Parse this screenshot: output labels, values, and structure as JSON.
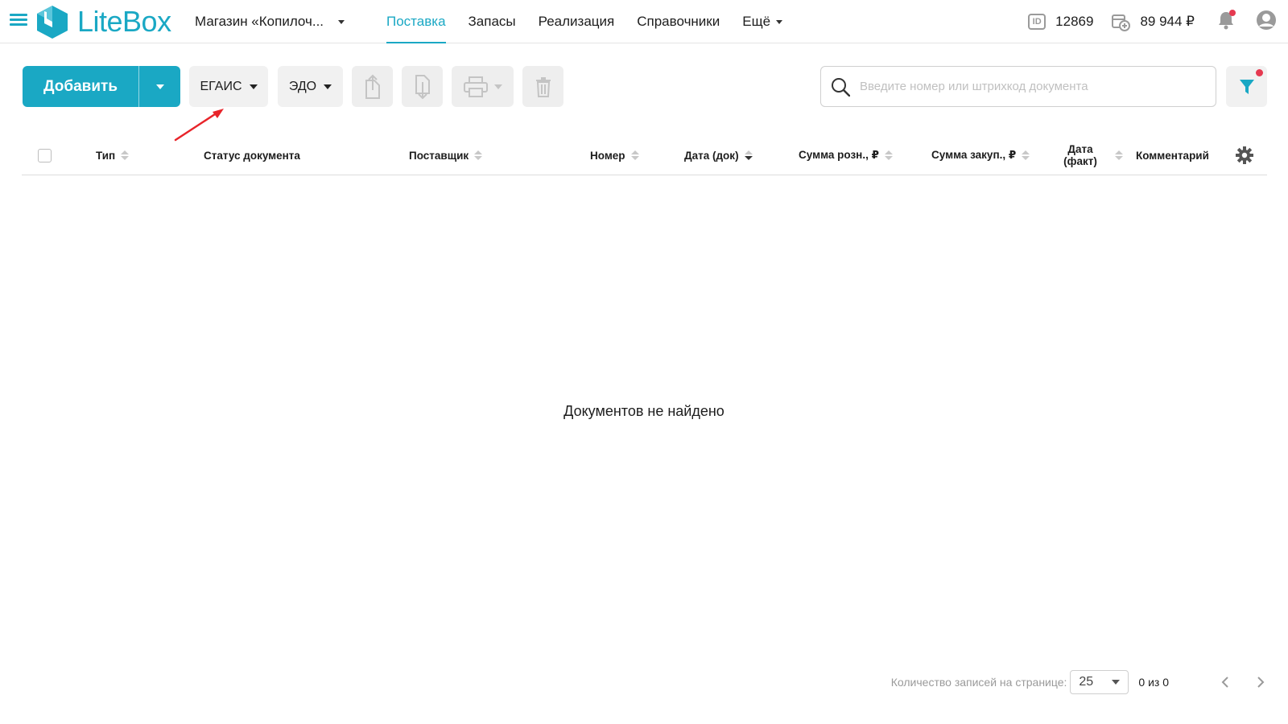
{
  "header": {
    "brand": "LiteBox",
    "store": "Магазин «Копилоч...",
    "nav": [
      {
        "label": "Поставка",
        "active": true
      },
      {
        "label": "Запасы",
        "active": false
      },
      {
        "label": "Реализация",
        "active": false
      },
      {
        "label": "Справочники",
        "active": false
      },
      {
        "label": "Ещё",
        "active": false
      }
    ],
    "account_id_icon": "id-card-icon",
    "account_id": "12869",
    "balance_icon": "wallet-add-icon",
    "balance": "89 944 ₽",
    "notifications_icon": "bell-icon",
    "user_icon": "user-icon",
    "accent_color": "#1aa8c4",
    "alert_color": "#e53950"
  },
  "toolbar": {
    "add_label": "Добавить",
    "egais_label": "ЕГАИС",
    "edo_label": "ЭДО",
    "export_icon": "upload-document-icon",
    "import_icon": "download-document-icon",
    "print_icon": "printer-icon",
    "delete_icon": "trash-icon",
    "search_placeholder": "Введите номер или штрихкод документа",
    "filter_icon": "funnel-icon"
  },
  "table": {
    "columns": [
      "Тип",
      "Статус документа",
      "Поставщик",
      "Номер",
      "Дата (док)",
      "Сумма розн., ₽",
      "Сумма закуп., ₽",
      "Дата (факт)",
      "Комментарий"
    ],
    "date_fact_line1": "Дата",
    "date_fact_line2": "(факт)",
    "settings_icon": "gear-icon",
    "empty_text": "Документов не найдено"
  },
  "pagination": {
    "label": "Количество записей на странице:",
    "per_page": "25",
    "count": "0 из 0",
    "prev_icon": "chevron-left-icon",
    "next_icon": "chevron-right-icon"
  }
}
